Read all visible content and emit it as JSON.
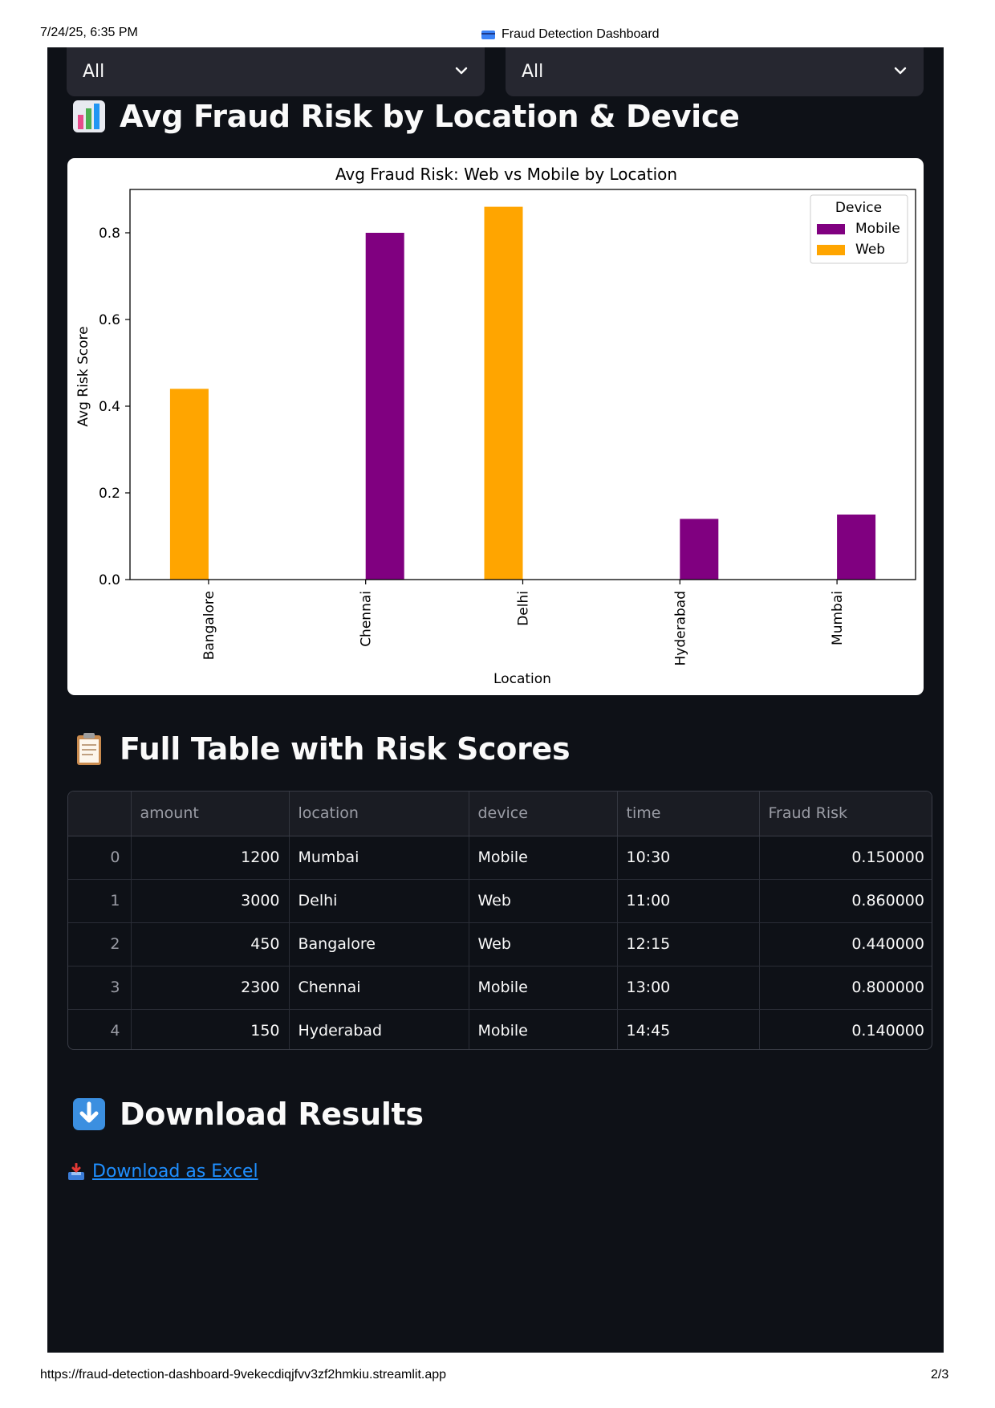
{
  "print_header": {
    "datetime": "7/24/25, 6:35 PM",
    "page_title": "Fraud Detection Dashboard"
  },
  "print_footer": {
    "url": "https://fraud-detection-dashboard-9vekecdiqjfvv3zf2hmkiu.streamlit.app",
    "page": "2/3"
  },
  "filters": [
    {
      "selected": "All"
    },
    {
      "selected": "All"
    }
  ],
  "sections": {
    "chart_title": "Avg Fraud Risk by Location & Device",
    "table_title": "Full Table with Risk Scores",
    "download_title": "Download Results"
  },
  "download_link_label": "Download as Excel",
  "colors": {
    "app_background": "#0e1117",
    "mobile": "#800080",
    "web": "#ffa500",
    "link": "#1f8fff"
  },
  "chart_data": {
    "type": "bar",
    "title": "Avg Fraud Risk: Web vs Mobile by Location",
    "xlabel": "Location",
    "ylabel": "Avg Risk Score",
    "categories": [
      "Bangalore",
      "Chennai",
      "Delhi",
      "Hyderabad",
      "Mumbai"
    ],
    "series": [
      {
        "name": "Mobile",
        "values": [
          null,
          0.8,
          null,
          0.14,
          0.15
        ]
      },
      {
        "name": "Web",
        "values": [
          0.44,
          null,
          0.86,
          null,
          null
        ]
      }
    ],
    "yticks": [
      "0.0",
      "0.2",
      "0.4",
      "0.6",
      "0.8"
    ],
    "ylim": [
      0,
      0.9
    ],
    "legend_title": "Device",
    "legend_position": "top-right",
    "grid": false
  },
  "table": {
    "columns": [
      "",
      "amount",
      "location",
      "device",
      "time",
      "Fraud Risk"
    ],
    "rows": [
      {
        "index": "0",
        "amount": "1200",
        "location": "Mumbai",
        "device": "Mobile",
        "time": "10:30",
        "risk": "0.150000"
      },
      {
        "index": "1",
        "amount": "3000",
        "location": "Delhi",
        "device": "Web",
        "time": "11:00",
        "risk": "0.860000"
      },
      {
        "index": "2",
        "amount": "450",
        "location": "Bangalore",
        "device": "Web",
        "time": "12:15",
        "risk": "0.440000"
      },
      {
        "index": "3",
        "amount": "2300",
        "location": "Chennai",
        "device": "Mobile",
        "time": "13:00",
        "risk": "0.800000"
      },
      {
        "index": "4",
        "amount": "150",
        "location": "Hyderabad",
        "device": "Mobile",
        "time": "14:45",
        "risk": "0.140000"
      }
    ]
  }
}
